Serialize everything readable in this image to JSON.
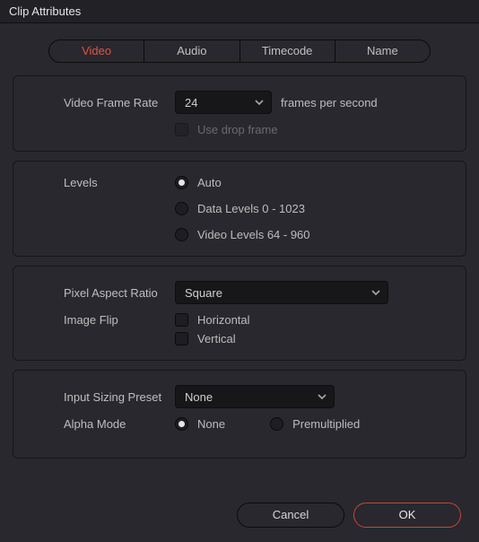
{
  "title": "Clip Attributes",
  "tabs": {
    "video": "Video",
    "audio": "Audio",
    "timecode": "Timecode",
    "name": "Name"
  },
  "frameRate": {
    "label": "Video Frame Rate",
    "value": "24",
    "suffix": "frames per second",
    "dropFrameLabel": "Use drop frame"
  },
  "levels": {
    "label": "Levels",
    "auto": "Auto",
    "data": "Data Levels 0 - 1023",
    "video": "Video Levels 64 - 960"
  },
  "aspect": {
    "labelPar": "Pixel Aspect Ratio",
    "parValue": "Square",
    "labelFlip": "Image Flip",
    "horizontal": "Horizontal",
    "vertical": "Vertical"
  },
  "sizing": {
    "labelPreset": "Input Sizing Preset",
    "presetValue": "None",
    "labelAlpha": "Alpha Mode",
    "alphaNone": "None",
    "alphaPremult": "Premultiplied"
  },
  "footer": {
    "cancel": "Cancel",
    "ok": "OK"
  }
}
